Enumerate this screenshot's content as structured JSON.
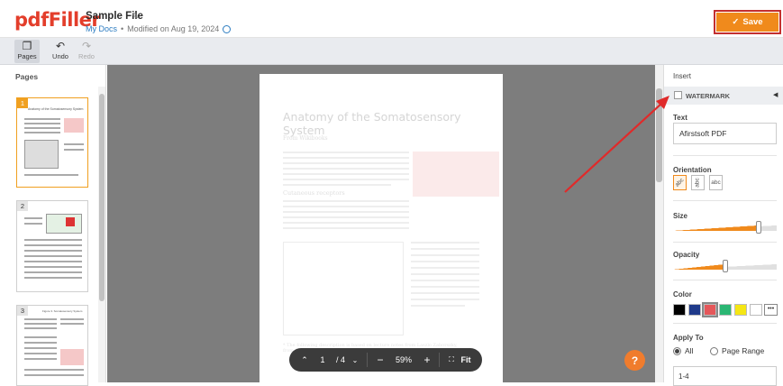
{
  "header": {
    "logo": "pdfFiller",
    "file_title": "Sample File",
    "breadcrumb": "My Docs",
    "separator": "•",
    "modified": "Modified on Aug 19, 2024",
    "save_label": "Save"
  },
  "toolbar": {
    "pages_label": "Pages",
    "undo_label": "Undo",
    "redo_label": "Redo"
  },
  "left_panel": {
    "title": "Pages",
    "thumbs": [
      {
        "num": "1",
        "caption": "Anatomy of the Somatosensory System"
      },
      {
        "num": "2"
      },
      {
        "num": "3",
        "caption": "Figure 3. Somatosensory System"
      }
    ]
  },
  "document": {
    "title": "Anatomy of the Somatosensory System",
    "author": "From Wikibooks",
    "heading1": "Cutaneous receptors",
    "footnote": "* The following description is based on lecture notes from Laszlo Zaborszky, from Rutgers University."
  },
  "zoom": {
    "page_current": "1",
    "page_total": "/ 4",
    "zoom_level": "59%",
    "fit_label": "Fit"
  },
  "help": {
    "label": "?"
  },
  "right_panel": {
    "title": "Insert",
    "watermark_label": "WATERMARK",
    "text_label": "Text",
    "text_value": "Afirstsoft PDF",
    "orientation_label": "Orientation",
    "orientation_options": [
      "abc",
      "abc",
      "abc"
    ],
    "size_label": "Size",
    "size_value": 0.83,
    "opacity_label": "Opacity",
    "opacity_value": 0.5,
    "color_label": "Color",
    "colors": [
      "#000000",
      "#1f3a8a",
      "#e5575a",
      "#2bb673",
      "#f5e614",
      "#ffffff"
    ],
    "selected_color": "#e5575a",
    "more_colors": "•••",
    "apply_label": "Apply To",
    "apply_all": "All",
    "apply_range": "Page Range",
    "range_value": "1-4"
  }
}
